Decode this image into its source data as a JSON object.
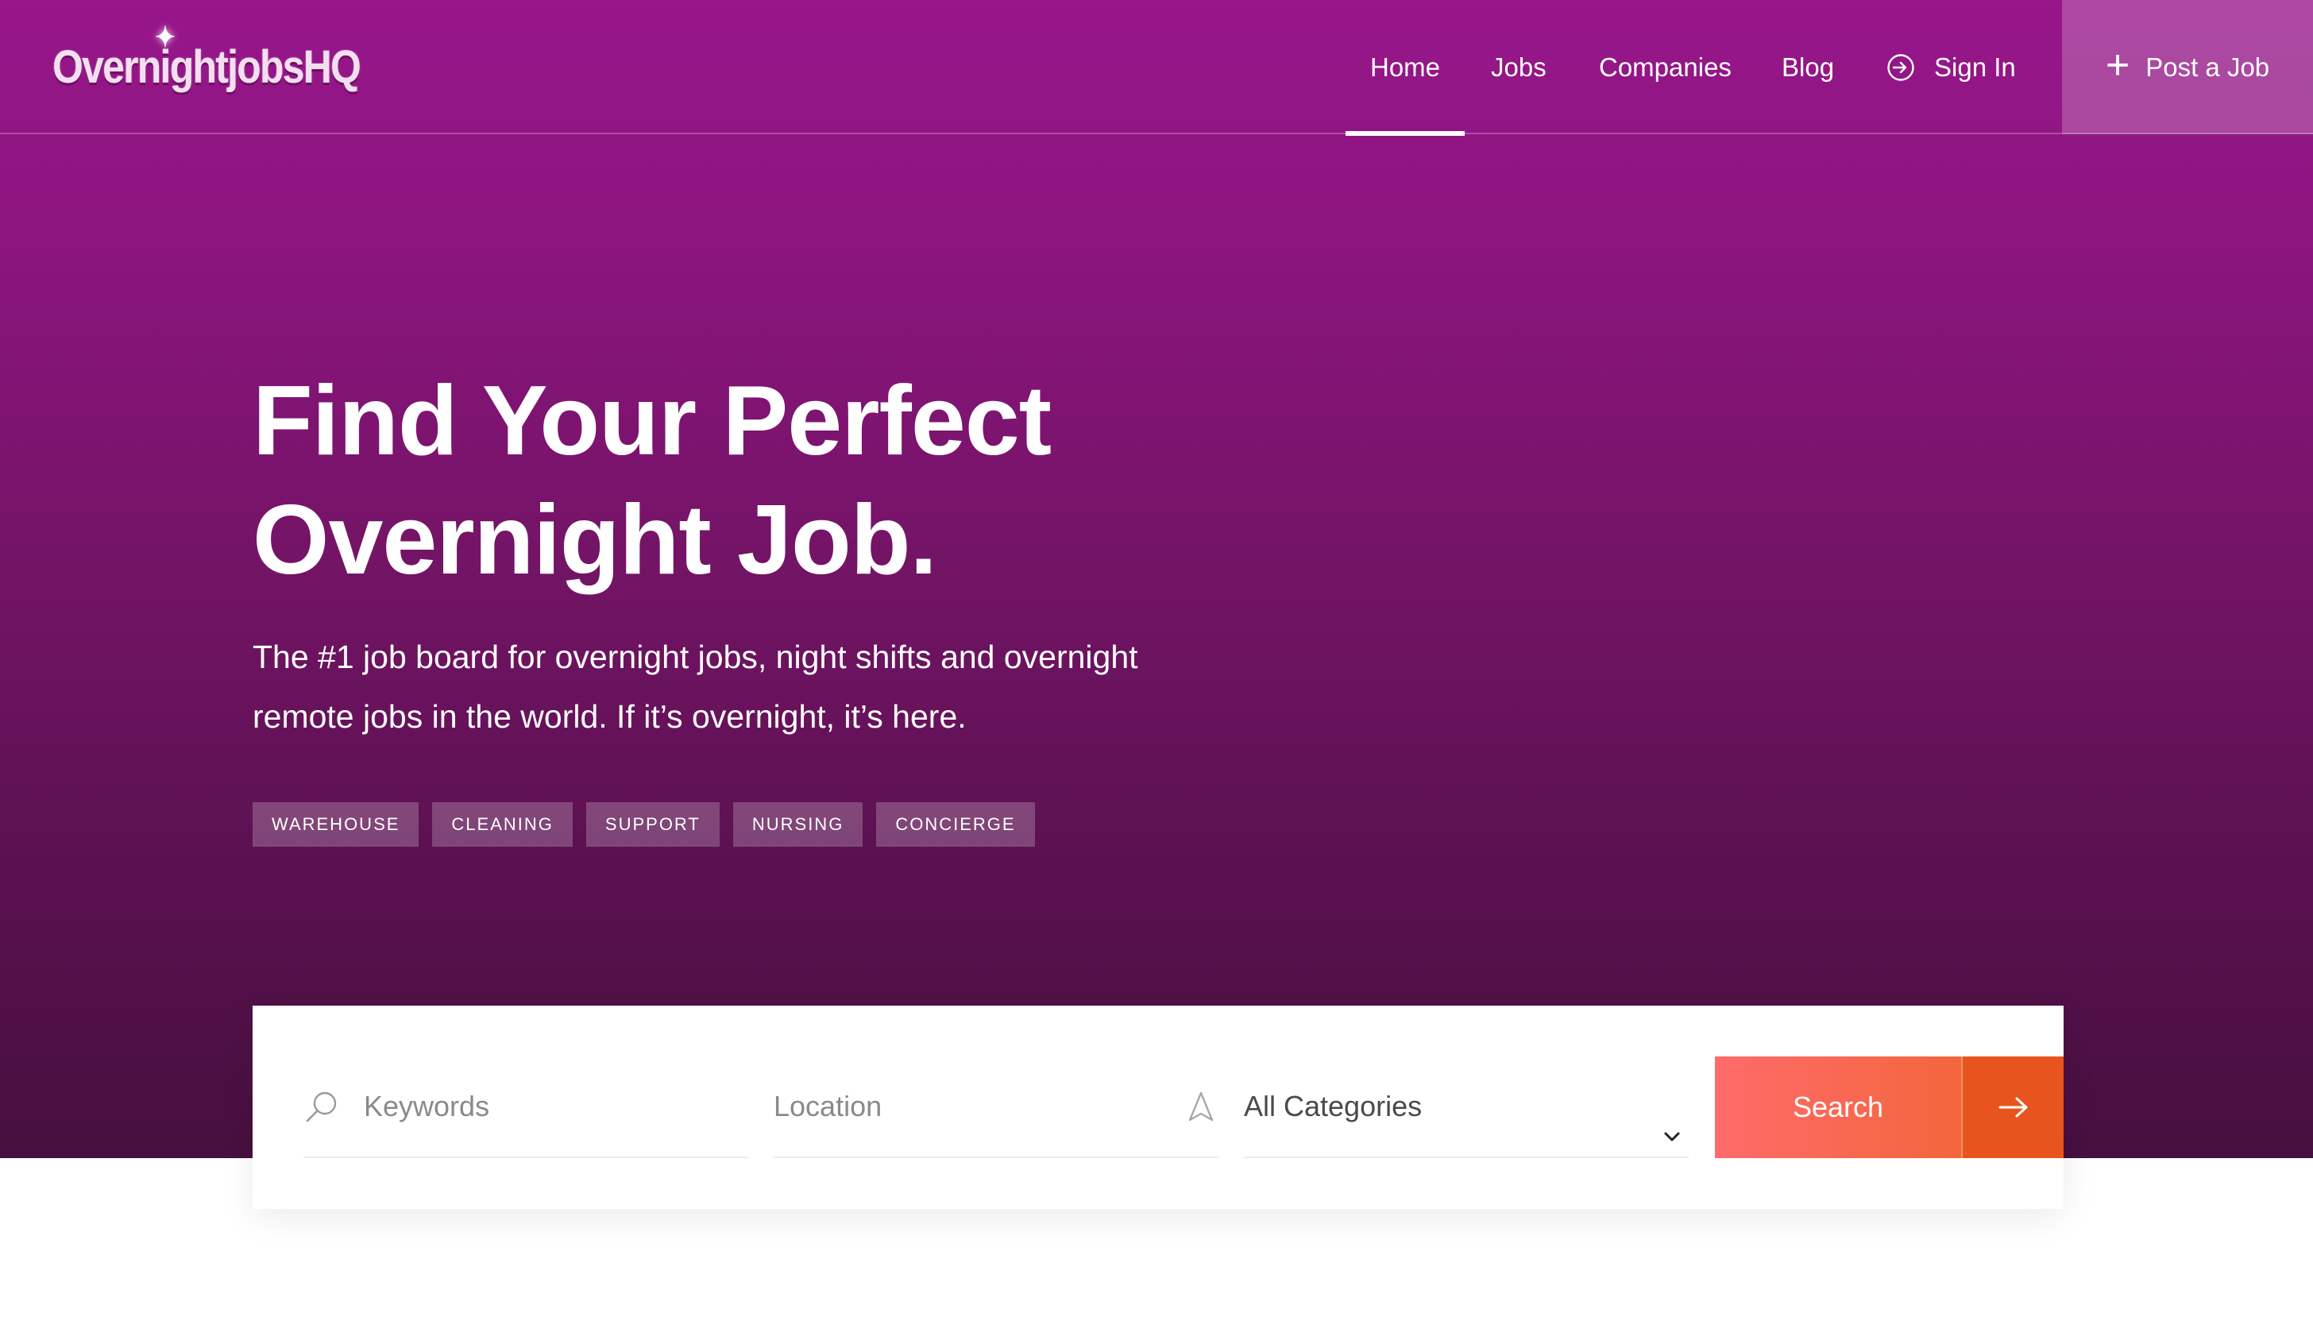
{
  "brand": {
    "logo_text": "OvernightjobsHQ"
  },
  "nav": {
    "items": [
      {
        "label": "Home",
        "active": true
      },
      {
        "label": "Jobs"
      },
      {
        "label": "Companies"
      },
      {
        "label": "Blog"
      }
    ],
    "sign_in": "Sign In",
    "post_job": "Post a Job"
  },
  "hero": {
    "title_line1": "Find Your Perfect",
    "title_line2": "Overnight Job.",
    "subtitle_line1": "The #1 job board for overnight jobs, night shifts and overnight",
    "subtitle_line2": "remote jobs in the world. If it’s overnight, it’s here.",
    "tags": [
      "WAREHOUSE",
      "CLEANING",
      "SUPPORT",
      "NURSING",
      "CONCIERGE"
    ]
  },
  "search": {
    "keywords_placeholder": "Keywords",
    "location_placeholder": "Location",
    "category_selected": "All Categories",
    "button_label": "Search"
  },
  "colors": {
    "hero_top": "#97168a",
    "hero_bottom": "#46103e",
    "search_button": "#f3663c",
    "search_arrow": "#e8541e"
  }
}
